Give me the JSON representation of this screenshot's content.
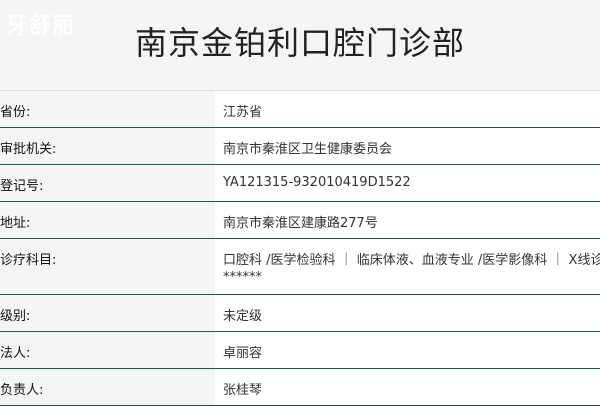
{
  "watermark": "牙舒丽",
  "title": "南京金铂利口腔门诊部",
  "rows": [
    {
      "label": "省份:",
      "value": "江苏省"
    },
    {
      "label": "审批机关:",
      "value": "南京市秦淮区卫生健康委员会"
    },
    {
      "label": "登记号:",
      "value": "YA121315-932010419D1522"
    },
    {
      "label": "地址:",
      "value": "南京市秦淮区建康路277号"
    },
    {
      "label": "诊疗科目:",
      "value_lines": [
        "口腔科 /医学检验科 ｜ 临床体液、血液专业 /医学影像科 ｜ X线诊断",
        "******"
      ]
    },
    {
      "label": "级别:",
      "value": "未定级"
    },
    {
      "label": "法人:",
      "value": "卓丽容"
    },
    {
      "label": "负责人:",
      "value": "张桂琴"
    }
  ],
  "colors": {
    "background": "#f4f5f4",
    "row_divider": "#1f5a3e",
    "value_bg": "#ffffff"
  }
}
